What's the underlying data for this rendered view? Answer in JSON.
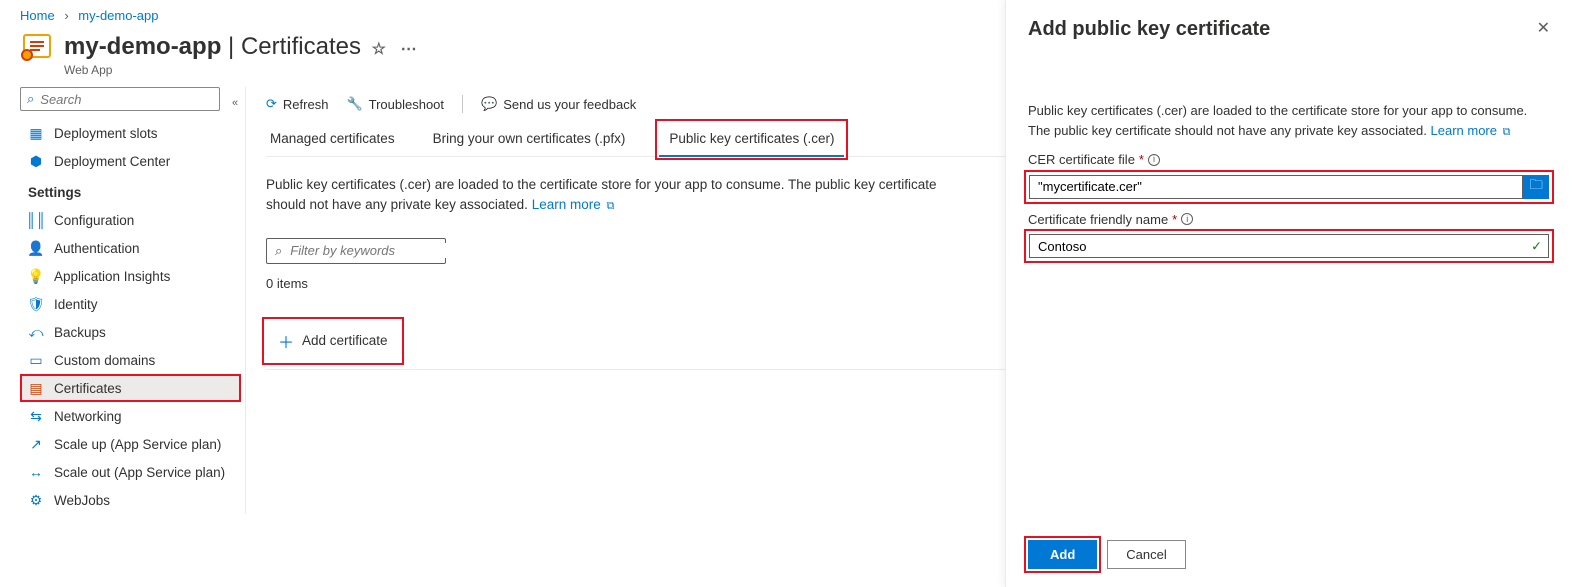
{
  "breadcrumb": {
    "home": "Home",
    "app": "my-demo-app"
  },
  "header": {
    "app_name": "my-demo-app",
    "section": "Certificates",
    "subtitle": "Web App"
  },
  "sidebar": {
    "search_placeholder": "Search",
    "items_top": [
      {
        "label": "Deployment slots"
      },
      {
        "label": "Deployment Center"
      }
    ],
    "section_label": "Settings",
    "items": [
      {
        "label": "Configuration"
      },
      {
        "label": "Authentication"
      },
      {
        "label": "Application Insights"
      },
      {
        "label": "Identity"
      },
      {
        "label": "Backups"
      },
      {
        "label": "Custom domains"
      },
      {
        "label": "Certificates"
      },
      {
        "label": "Networking"
      },
      {
        "label": "Scale up (App Service plan)"
      },
      {
        "label": "Scale out (App Service plan)"
      },
      {
        "label": "WebJobs"
      }
    ]
  },
  "toolbar": {
    "refresh": "Refresh",
    "troubleshoot": "Troubleshoot",
    "feedback": "Send us your feedback"
  },
  "tabs": {
    "managed": "Managed certificates",
    "byo": "Bring your own certificates (.pfx)",
    "public": "Public key certificates (.cer)"
  },
  "desc": {
    "text": "Public key certificates (.cer) are loaded to the certificate store for your app to consume. The public key certificate should not have any private key associated.",
    "learn_more": "Learn more"
  },
  "filter": {
    "placeholder": "Filter by keywords"
  },
  "list": {
    "count": "0 items",
    "add_label": "Add certificate"
  },
  "panel": {
    "title": "Add public key certificate",
    "intro": "Public key certificates (.cer) are loaded to the certificate store for your app to consume. The public key certificate should not have any private key associated.",
    "learn_more": "Learn more",
    "file_label": "CER certificate file",
    "file_value": "\"mycertificate.cer\"",
    "name_label": "Certificate friendly name",
    "name_value": "Contoso",
    "add_btn": "Add",
    "cancel_btn": "Cancel"
  }
}
